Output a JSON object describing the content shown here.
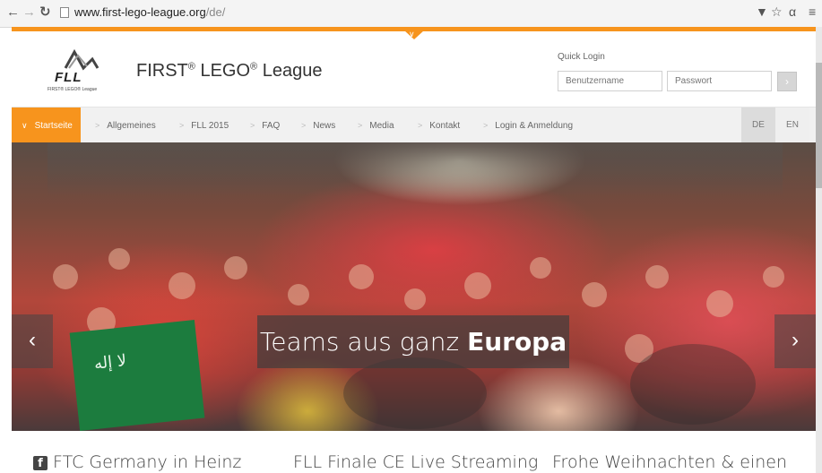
{
  "browser": {
    "url_domain": "www.first-lego-league.org",
    "url_path": "/de/",
    "icons": [
      "back-arrow-icon",
      "forward-arrow-icon",
      "reload-icon",
      "page-icon",
      "extension-icon",
      "bookmark-star-icon",
      "addon-icon",
      "menu-icon"
    ]
  },
  "header": {
    "logo_text": "FLL",
    "logo_subtext": "FIRST® LEGO® League",
    "title_first": "FIRST",
    "title_lego": " LEGO",
    "title_league": " League",
    "reg": "®",
    "quick_login_label": "Quick Login",
    "username_placeholder": "Benutzername",
    "password_placeholder": "Passwort",
    "login_button_glyph": "›"
  },
  "nav": {
    "items": [
      {
        "label": "Startseite",
        "active": true
      },
      {
        "label": "Allgemeines"
      },
      {
        "label": "FLL 2015"
      },
      {
        "label": "FAQ"
      },
      {
        "label": "News"
      },
      {
        "label": "Media"
      },
      {
        "label": "Kontakt"
      },
      {
        "label": "Login & Anmeldung"
      }
    ],
    "lang_de": "DE",
    "lang_en": "EN"
  },
  "hero": {
    "caption_prefix": "Teams aus ganz ",
    "caption_bold": "Europa",
    "prev_glyph": "‹",
    "next_glyph": "›"
  },
  "teasers": [
    {
      "title": "FTC Germany in Heinz"
    },
    {
      "title": "FLL Finale CE Live Streaming"
    },
    {
      "title": "Frohe Weihnachten & einen"
    }
  ],
  "colors": {
    "accent": "#f7941d",
    "nav_bg": "#f1f1f1"
  }
}
